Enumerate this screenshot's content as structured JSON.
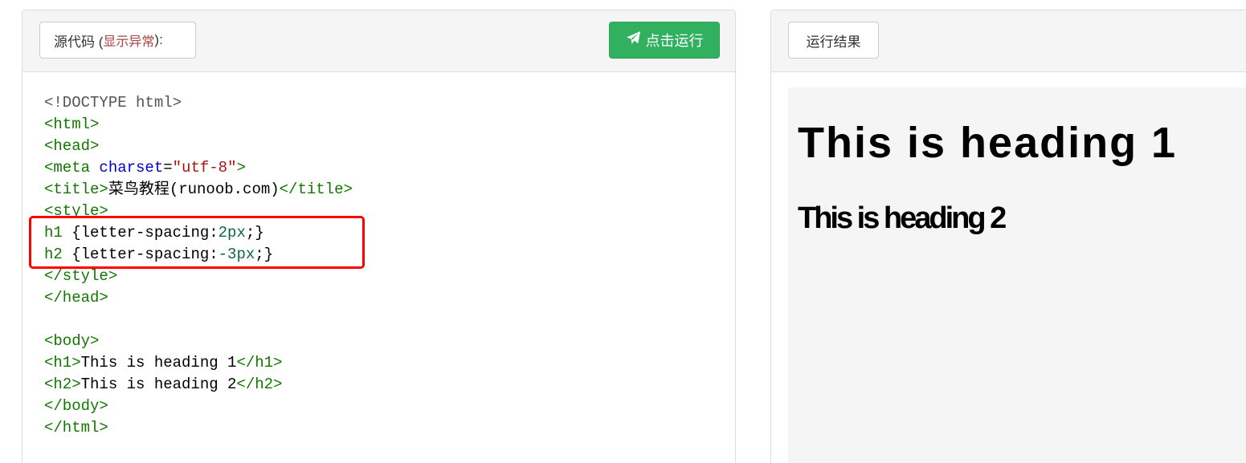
{
  "source_panel": {
    "title_prefix": "源代码 (",
    "title_error": "显示异常",
    "title_suffix": "):",
    "run_button": "点击运行",
    "run_icon": "paper-plane-icon"
  },
  "code_lines": [
    [
      {
        "t": "<!DOCTYPE html>",
        "c": "meta"
      }
    ],
    [
      {
        "t": "<html>",
        "c": "tag"
      }
    ],
    [
      {
        "t": "<head>",
        "c": "tag"
      }
    ],
    [
      {
        "t": "<meta ",
        "c": "tag"
      },
      {
        "t": "charset",
        "c": "attr"
      },
      {
        "t": "=",
        "c": "prop"
      },
      {
        "t": "\"utf-8\"",
        "c": "str"
      },
      {
        "t": ">",
        "c": "tag"
      }
    ],
    [
      {
        "t": "<title>",
        "c": "tag"
      },
      {
        "t": "菜鸟教程(runoob.com)",
        "c": "prop"
      },
      {
        "t": "</title>",
        "c": "tag"
      }
    ],
    [
      {
        "t": "<style>",
        "c": "tag"
      }
    ],
    [
      {
        "t": "h1",
        "c": "sel"
      },
      {
        "t": " {letter-spacing:",
        "c": "prop"
      },
      {
        "t": "2px",
        "c": "num"
      },
      {
        "t": ";}",
        "c": "prop"
      }
    ],
    [
      {
        "t": "h2",
        "c": "sel"
      },
      {
        "t": " {letter-spacing:",
        "c": "prop"
      },
      {
        "t": "-3px",
        "c": "num"
      },
      {
        "t": ";}",
        "c": "prop"
      }
    ],
    [
      {
        "t": "</style>",
        "c": "tag"
      }
    ],
    [
      {
        "t": "</head>",
        "c": "tag"
      }
    ],
    [
      {
        "t": "",
        "c": "prop"
      }
    ],
    [
      {
        "t": "<body>",
        "c": "tag"
      }
    ],
    [
      {
        "t": "<h1>",
        "c": "tag"
      },
      {
        "t": "This is heading 1",
        "c": "prop"
      },
      {
        "t": "</h1>",
        "c": "tag"
      }
    ],
    [
      {
        "t": "<h2>",
        "c": "tag"
      },
      {
        "t": "This is heading 2",
        "c": "prop"
      },
      {
        "t": "</h2>",
        "c": "tag"
      }
    ],
    [
      {
        "t": "</body>",
        "c": "tag"
      }
    ],
    [
      {
        "t": "</html>",
        "c": "tag"
      }
    ]
  ],
  "result_panel": {
    "title": "运行结果",
    "h1_text": "This is heading 1",
    "h2_text": "This is heading 2"
  },
  "colors": {
    "run_button_bg": "#31b15f",
    "error_text": "#a94442",
    "highlight_border": "#ff0000",
    "code_tag": "#117700",
    "code_attr": "#0000cc",
    "code_string": "#aa1111",
    "code_number": "#116644"
  }
}
